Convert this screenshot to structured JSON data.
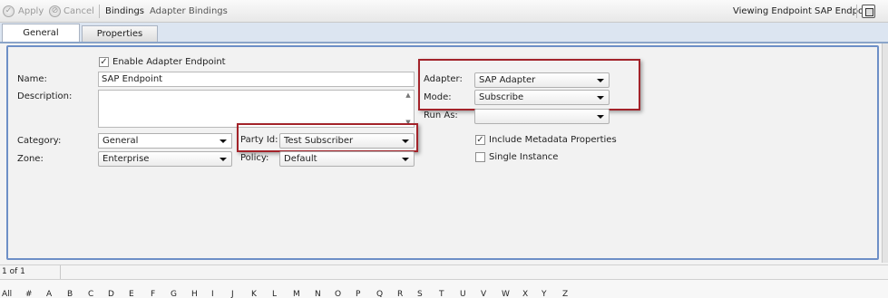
{
  "toolbar": {
    "apply_label": "Apply",
    "cancel_label": "Cancel",
    "bindings_label": "Bindings",
    "adapter_bindings_label": "Adapter Bindings",
    "status_text": "Viewing Endpoint SAP Endpoint"
  },
  "tabs": [
    {
      "label": "General",
      "active": true
    },
    {
      "label": "Properties",
      "active": false
    }
  ],
  "form": {
    "enable_adapter_label": "Enable Adapter Endpoint",
    "enable_adapter_checked": true,
    "name_label": "Name:",
    "name_value": "SAP Endpoint",
    "description_label": "Description:",
    "description_value": "",
    "category_label": "Category:",
    "category_value": "General",
    "zone_label": "Zone:",
    "zone_value": "Enterprise",
    "party_id_label": "Party Id:",
    "party_id_value": "Test Subscriber",
    "policy_label": "Policy:",
    "policy_value": "Default",
    "adapter_label": "Adapter:",
    "adapter_value": "SAP Adapter",
    "mode_label": "Mode:",
    "mode_value": "Subscribe",
    "run_as_label": "Run As:",
    "run_as_value": "",
    "include_metadata_label": "Include Metadata Properties",
    "include_metadata_checked": true,
    "single_instance_label": "Single Instance",
    "single_instance_checked": false
  },
  "pager": {
    "text": "1 of 1"
  },
  "alphabet": [
    "All",
    "#",
    "A",
    "B",
    "C",
    "D",
    "E",
    "F",
    "G",
    "H",
    "I",
    "J",
    "K",
    "L",
    "M",
    "N",
    "O",
    "P",
    "Q",
    "R",
    "S",
    "T",
    "U",
    "V",
    "W",
    "X",
    "Y",
    "Z"
  ],
  "colors": {
    "accent_blue": "#6d8fc7",
    "highlight_red": "#a3232a"
  }
}
